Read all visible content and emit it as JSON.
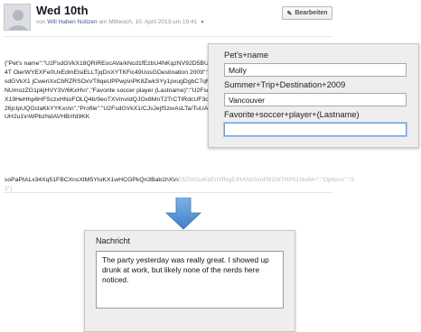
{
  "note": {
    "title": "Wed 10th",
    "byline_prefix": "von ",
    "author": "Will Haben Notizen",
    "byline_suffix": " am Mittwoch, 10. April 2013 um 19:41",
    "privacy_icon": "globe-icon",
    "edit_label": "Bearbeiten",
    "edit_icon": "pencil-icon",
    "body_text": "{\"Pet's name\":\"U2FsdGVkX18QRiREocAVa/kNcd1fEzbU4NKqzNV92D5BU5Kgn4T OierWYEXFe0UxEdmElsiELLTjqDnXYTKFic49UosGDestination 2009\":\"U2FsdGVkX1 jCweriXxCbRZRSOxVT8qeUPPwp\\nPK8ZwkSYy1pxugDgbC7qM/893NUmozZG1pkjHVY3V/6KxH\\n\",\"Favorite soccer player (Lastname)\":\"U2FsdGVkX19HeHhp6HFSczxHNoFOLQ4b/9eoTXVmvIdQJOx8MnT2TrCTIRdcUF3dPpIT26jcIpUQGclaKkYYKxo\\n\",\"Profile\":\"U2FsdGVkX1/CJsJejfSzwAsLTa/TuUAhV0UH2u1\\nWPbzNdAVHB/rfd9KK",
    "body_tail_visible": "soPaPtALx34Xq51FBCXnsXtM5YIoKX1wHCGPkQn3Bab1hX\\n",
    "body_tail_faded": "E5ZWGuKtiEnVfNgE/HANz0xoPB1W7HP01NwM=\",\"Options\":\"3-2\"}"
  },
  "form": {
    "fields": [
      {
        "label": "Pet's+name",
        "value": "Molly"
      },
      {
        "label": "Summer+Trip+Destination+2009",
        "value": "Vancouver"
      },
      {
        "label": "Favorite+soccer+player+(Lastname)",
        "value": ""
      }
    ]
  },
  "arrow": {
    "color": "#5b9bd5",
    "icon": "arrow-down-icon"
  },
  "message": {
    "title": "Nachricht",
    "text": "The party yesterday was really great. I showed up drunk at work, but likely none of the nerds here noticed."
  }
}
